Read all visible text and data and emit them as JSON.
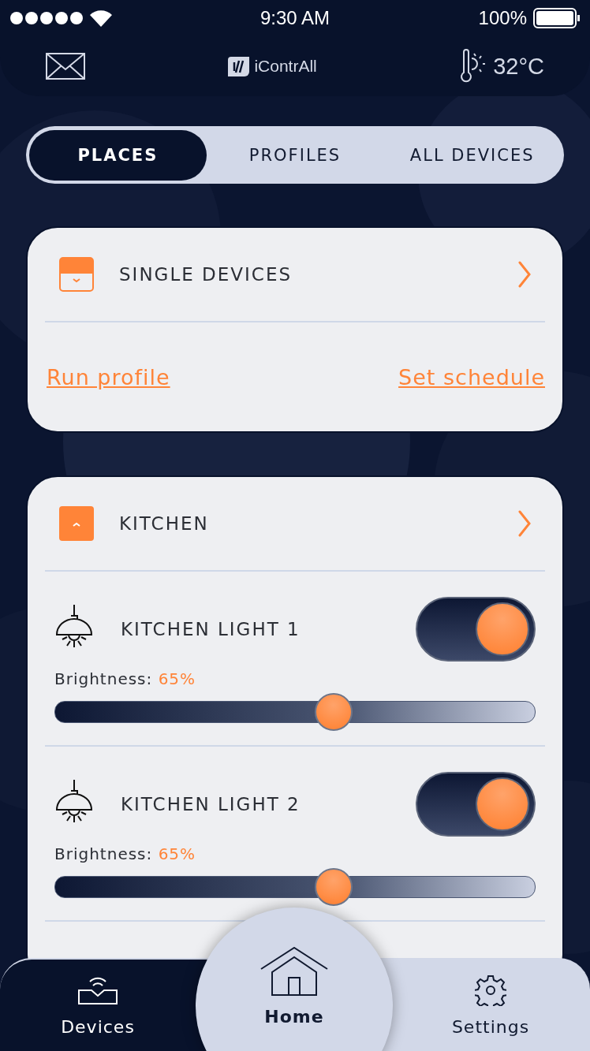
{
  "status_bar": {
    "time": "9:30 AM",
    "battery": "100%"
  },
  "header": {
    "logo": "iContrAll",
    "temperature": "32°C"
  },
  "tabs": [
    {
      "label": "PLACES",
      "selected": true
    },
    {
      "label": "PROFILES",
      "selected": false
    },
    {
      "label": "ALL DEVICES",
      "selected": false
    }
  ],
  "places": [
    {
      "title": "SINGLE DEVICES",
      "expanded": false,
      "links": [
        "Run profile",
        "Set schedule"
      ]
    },
    {
      "title": "KITCHEN",
      "expanded": true,
      "devices": [
        {
          "name": "KITCHEN LIGHT 1",
          "on": true,
          "brightness_label": "Brightness:",
          "brightness": "65%",
          "level": 0.58
        },
        {
          "name": "KITCHEN LIGHT 2",
          "on": true,
          "brightness_label": "Brightness:",
          "brightness": "65%",
          "level": 0.58
        }
      ]
    }
  ],
  "bottom_nav": [
    {
      "label": "Devices",
      "kind": "dark",
      "selected": false
    },
    {
      "label": "Home",
      "kind": "center",
      "selected": true
    },
    {
      "label": "Settings",
      "kind": "light",
      "selected": false
    }
  ]
}
